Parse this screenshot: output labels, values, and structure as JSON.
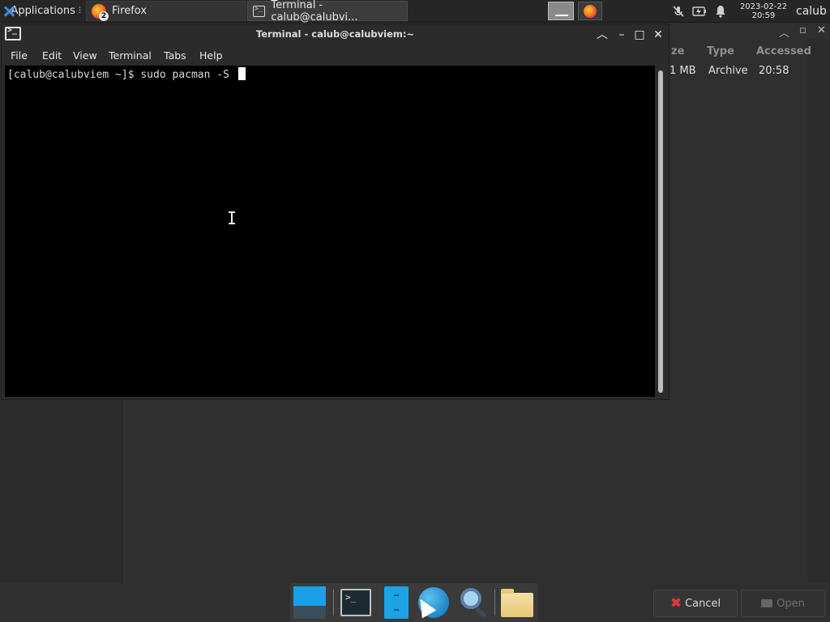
{
  "panel": {
    "applications_label": "Applications",
    "applications_sep": "⠇",
    "tasks": [
      {
        "label": "Firefox",
        "badge": "2"
      },
      {
        "label": "Terminal - calub@calubvi..."
      }
    ],
    "clock": {
      "date": "2023-02-22",
      "time": "20:59"
    },
    "user": "calub",
    "tray_icons": [
      "microphone-muted-icon",
      "battery-icon",
      "notification-bell-icon"
    ]
  },
  "terminal": {
    "title": "Terminal - calub@calubviem:~",
    "menu": [
      "File",
      "Edit",
      "View",
      "Terminal",
      "Tabs",
      "Help"
    ],
    "prompt": "[calub@calubviem ~]$ sudo pacman -S "
  },
  "chooser": {
    "columns": [
      "ze",
      "Type",
      "Accessed"
    ],
    "row": {
      "size": "1 MB",
      "type": "Archive",
      "accessed": "20:58"
    },
    "cancel_label": "Cancel",
    "open_label": "Open"
  },
  "dock": {
    "items": [
      "desktop-icon",
      "terminal-icon",
      "file-manager-icon",
      "web-browser-icon",
      "search-icon",
      "folder-icon"
    ]
  },
  "colors": {
    "accent": "#1ca3e6",
    "terminal_bg": "#000000",
    "cancel_x": "#e03a3a"
  }
}
